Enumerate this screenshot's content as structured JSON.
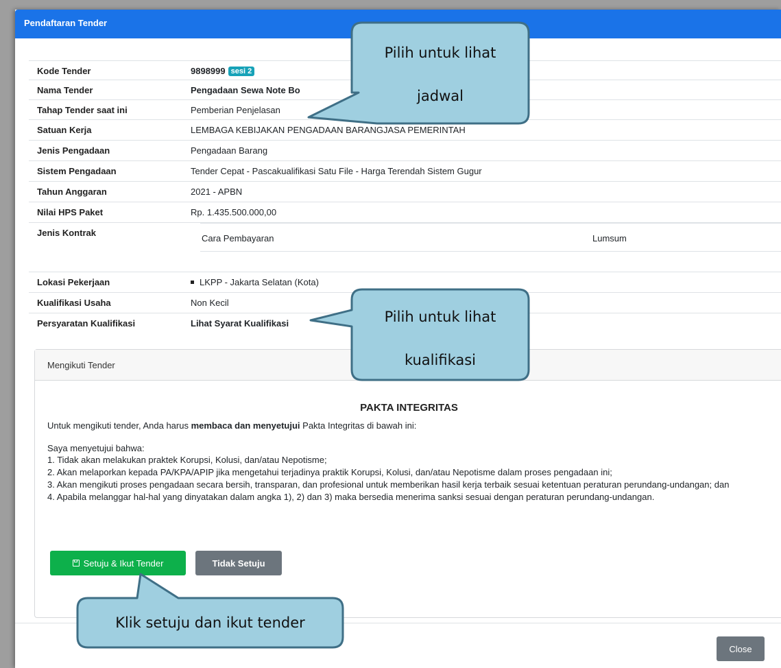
{
  "modal": {
    "title": "Pendaftaran Tender",
    "close_label": "Close"
  },
  "info": {
    "kode_label": "Kode Tender",
    "kode_value": "9898999",
    "kode_badge": "sesi 2",
    "nama_label": "Nama Tender",
    "nama_value": "Pengadaan Sewa Note Bo",
    "tahap_label": "Tahap Tender saat ini",
    "tahap_value": "Pemberian Penjelasan",
    "satker_label": "Satuan Kerja",
    "satker_value": "LEMBAGA KEBIJAKAN PENGADAAN BARANGJASA PEMERINTAH",
    "jenis_label": "Jenis Pengadaan",
    "jenis_value": "Pengadaan Barang",
    "sistem_label": "Sistem Pengadaan",
    "sistem_value": "Tender Cepat - Pascakualifikasi Satu File - Harga Terendah Sistem Gugur",
    "tahun_label": "Tahun Anggaran",
    "tahun_value": "2021 - APBN",
    "hps_label": "Nilai HPS Paket",
    "hps_value": "Rp. 1.435.500.000,00",
    "kontrak_label": "Jenis Kontrak",
    "kontrak_key": "Cara Pembayaran",
    "kontrak_value": "Lumsum",
    "lokasi_label": "Lokasi Pekerjaan",
    "lokasi_value": "LKPP - Jakarta Selatan (Kota)",
    "kualifikasi_label": "Kualifikasi Usaha",
    "kualifikasi_value": "Non Kecil",
    "syarat_label": "Persyaratan Kualifikasi",
    "syarat_value": "Lihat Syarat Kualifikasi"
  },
  "card": {
    "header": "Mengikuti Tender",
    "title": "PAKTA INTEGRITAS",
    "intro_pre": "Untuk mengikuti tender, Anda harus ",
    "intro_bold": "membaca dan menyetujui",
    "intro_post": " Pakta Integritas di bawah ini:",
    "agree": "Saya menyetujui bahwa:",
    "items": [
      "1. Tidak akan melakukan praktek Korupsi, Kolusi, dan/atau Nepotisme;",
      "2. Akan melaporkan kepada PA/KPA/APIP jika mengetahui terjadinya praktik Korupsi, Kolusi, dan/atau Nepotisme dalam proses pengadaan ini;",
      "3. Akan mengikuti proses pengadaan secara bersih, transparan, dan profesional untuk memberikan hasil kerja terbaik sesuai ketentuan peraturan perundang-undangan; dan",
      "4. Apabila melanggar hal-hal yang dinyatakan dalam angka 1), 2) dan 3) maka bersedia menerima sanksi sesuai dengan peraturan perundang-undangan."
    ],
    "btn_agree": "Setuju & Ikut Tender",
    "btn_disagree": "Tidak Setuju"
  },
  "callouts": {
    "jadwal_line1": "Pilih untuk lihat",
    "jadwal_line2": "jadwal",
    "kualifikasi_line1": "Pilih untuk lihat",
    "kualifikasi_line2": "kualifikasi",
    "setuju": "Klik setuju dan ikut tender"
  },
  "colors": {
    "header": "#1a73e8",
    "callout_fill": "#9fcfe0",
    "callout_border": "#3f6f86",
    "agree_button": "#0db04b",
    "grey_button": "#6c757d"
  }
}
